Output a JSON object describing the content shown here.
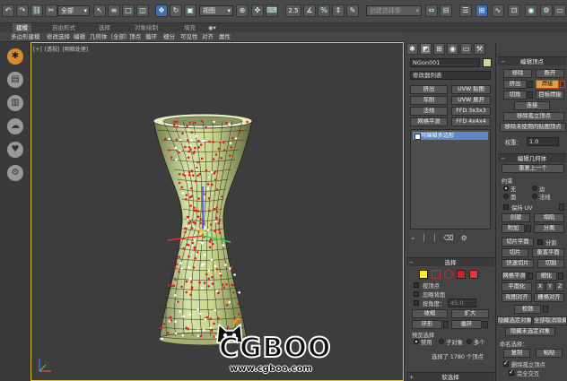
{
  "toolbar": {
    "filter_value": "全部",
    "coord_value": "视图",
    "snap_value": "2.5",
    "selection_set_placeholder": "创建选择集",
    "colors": {
      "active_blue": "#3f6fb0"
    }
  },
  "ribbon": {
    "tabs": [
      "建模",
      "自由形式",
      "选择",
      "对象绘制",
      "填充"
    ],
    "active_tab_index": 0,
    "row_items": [
      "多边形建模",
      "修改选择",
      "编辑",
      "几何体（全部）",
      "顶点",
      "循环",
      "细分",
      "可见性",
      "对齐",
      "属性"
    ]
  },
  "viewport": {
    "label_parts": [
      "[+]",
      "[透视]",
      "[明暗处理]"
    ],
    "border_color": "#e1c23a"
  },
  "watermark": {
    "word": "CGBOO",
    "url": "www.cgboo.com"
  },
  "panel": {
    "object_name": "NGon001",
    "modifier_list": "修改器列表",
    "modifier_buttons": [
      "挤出",
      "UVW 贴图",
      "车削",
      "UVW 展开",
      "法线",
      "FFD 3x3x3",
      "网格平滑",
      "FFD 4x4x4"
    ],
    "stack_item": "可编辑多边形",
    "selection": {
      "title": "选择",
      "by_vertex": "按顶点",
      "ignore_backfacing": "忽略背面",
      "by_angle": "按角度：",
      "angle_value": "45.0",
      "shrink": "收缩",
      "grow": "扩大",
      "ring": "环形",
      "loop": "循环",
      "preview_selection": "预览选择",
      "preview_off": "禁用",
      "preview_subobject": "子对象",
      "preview_multi": "多个",
      "status": "选择了 1780 个顶点"
    },
    "soft_selection": {
      "title": "软选择"
    },
    "edit_vertices": {
      "title": "编辑顶点",
      "remove": "移除",
      "break": "断开",
      "extrude": "挤出",
      "weld": "焊接",
      "chamfer": "切角",
      "target_weld": "目标焊接",
      "connect": "连接",
      "remove_isolated": "移除孤立顶点",
      "remove_unused_map": "移除未使用的贴图顶点",
      "weight_label": "权重：",
      "weight_value": "1.0"
    },
    "edit_geometry": {
      "title": "编辑几何体",
      "repeat_last": "重复上一个",
      "constraints": "约束",
      "none": "无",
      "edge": "边",
      "face": "面",
      "normal": "法线",
      "preserve_uv": "保持 UV",
      "create": "创建",
      "collapse": "塌陷",
      "attach": "附加",
      "detach": "分离",
      "slice_plane": "切片平面",
      "split": "分割",
      "slice": "切片",
      "reset_plane": "重置平面",
      "quickslice": "快速切片",
      "cut": "切割",
      "meshsmooth": "网格平滑",
      "tessellate": "细化",
      "make_planar": "平面化",
      "x": "X",
      "y": "Y",
      "z": "Z",
      "view_align": "视图对齐",
      "grid_align": "栅格对齐",
      "relax": "松弛",
      "hide_selected": "隐藏选定对象",
      "unhide_all": "全部取消隐藏",
      "hide_unselected": "隐藏未选定对象",
      "named_selections": "命名选择：",
      "copy": "复制",
      "paste": "粘贴",
      "delete_isolated": "删除孤立顶点",
      "full_interactivity": "完全交互"
    }
  }
}
